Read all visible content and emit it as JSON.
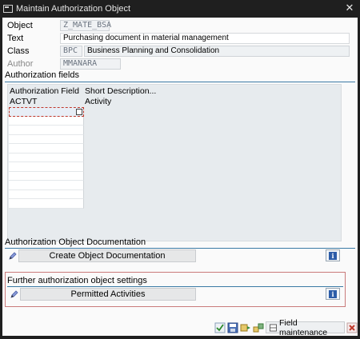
{
  "window": {
    "title": "Maintain Authorization Object"
  },
  "header": {
    "object_label": "Object",
    "object_value": "Z_MATE_BSA",
    "text_label": "Text",
    "text_value": "Purchasing document in material management",
    "class_label": "Class",
    "class_code": "BPC",
    "class_desc": "Business Planning and Consolidation",
    "author_label": "Author",
    "author_value": "MMANARA"
  },
  "auth_fields": {
    "section_title": "Authorization fields",
    "col_field": "Authorization Field",
    "col_desc": "Short Description...",
    "rows": [
      {
        "field": "ACTVT",
        "desc": "Activity"
      }
    ]
  },
  "documentation": {
    "section_title": "Authorization Object Documentation",
    "create_button": "Create Object Documentation"
  },
  "further": {
    "section_title": "Further authorization object settings",
    "permitted_button": "Permitted Activities"
  },
  "footer": {
    "field_maintenance": "Field maintenance"
  },
  "colors": {
    "section_line": "#3b7aa5",
    "highlight_box": "#c97b7b",
    "info_blue": "#2c5ca8"
  },
  "icons": [
    "window-icon",
    "close-icon",
    "pencil-icon",
    "info-icon",
    "check-icon",
    "save-icon",
    "find-icon",
    "transport-icon",
    "cancel-icon"
  ]
}
